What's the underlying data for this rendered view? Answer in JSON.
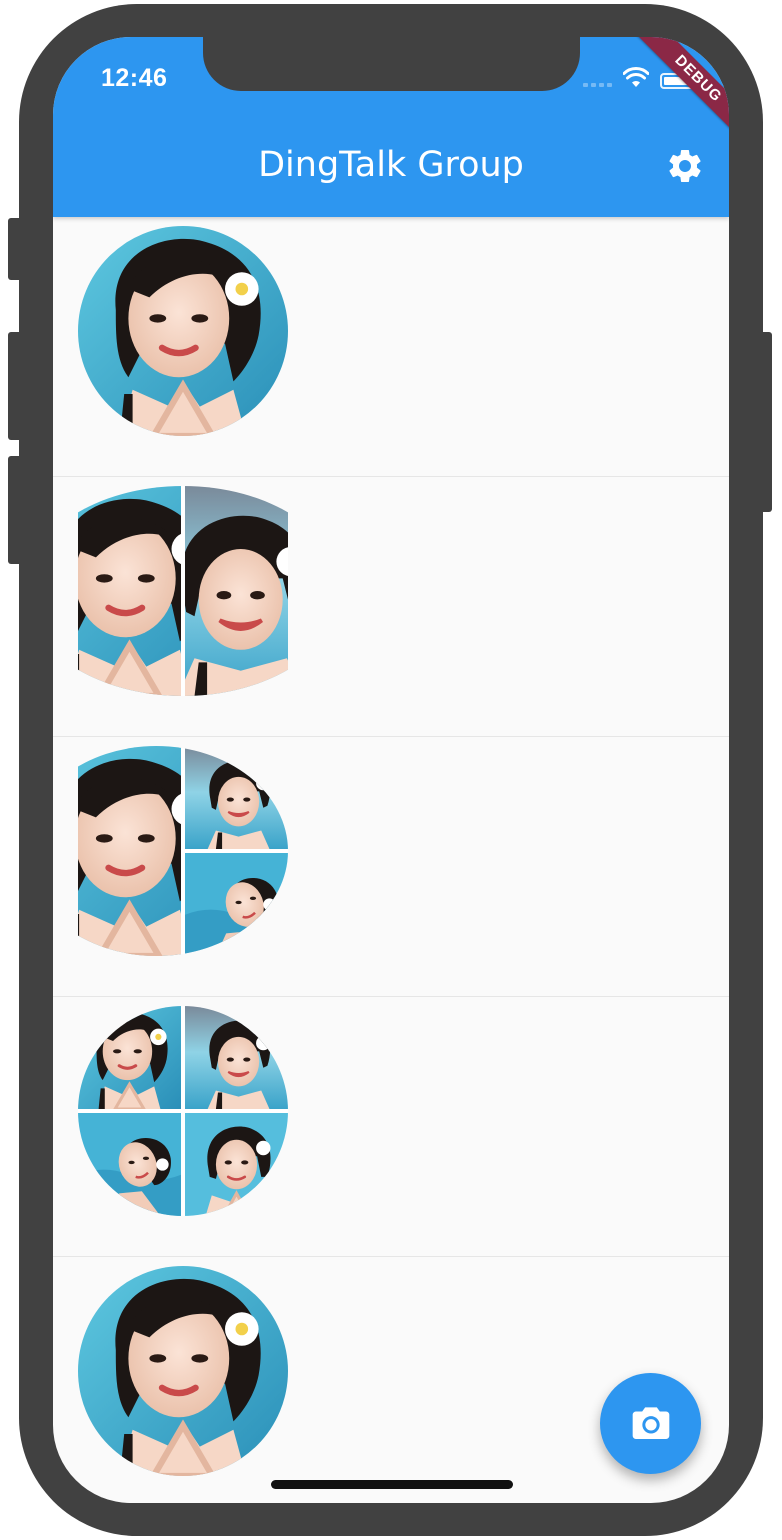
{
  "status_bar": {
    "time": "12:46"
  },
  "debug_banner": "DEBUG",
  "app_bar": {
    "title": "DingTalk Group",
    "settings_icon": "gear-icon"
  },
  "group_avatars": [
    {
      "label": "group-avatar-1-photo",
      "tiles": 1
    },
    {
      "label": "group-avatar-2-photos",
      "tiles": 2
    },
    {
      "label": "group-avatar-3-photos",
      "tiles": 3
    },
    {
      "label": "group-avatar-4-photos",
      "tiles": 4
    },
    {
      "label": "group-avatar-1-photo",
      "tiles": 1
    }
  ],
  "fab": {
    "icon": "camera-icon"
  },
  "colors": {
    "primary": "#2d96f0",
    "frame": "#414141",
    "background": "#fafafa",
    "debug": "#8b2846"
  }
}
